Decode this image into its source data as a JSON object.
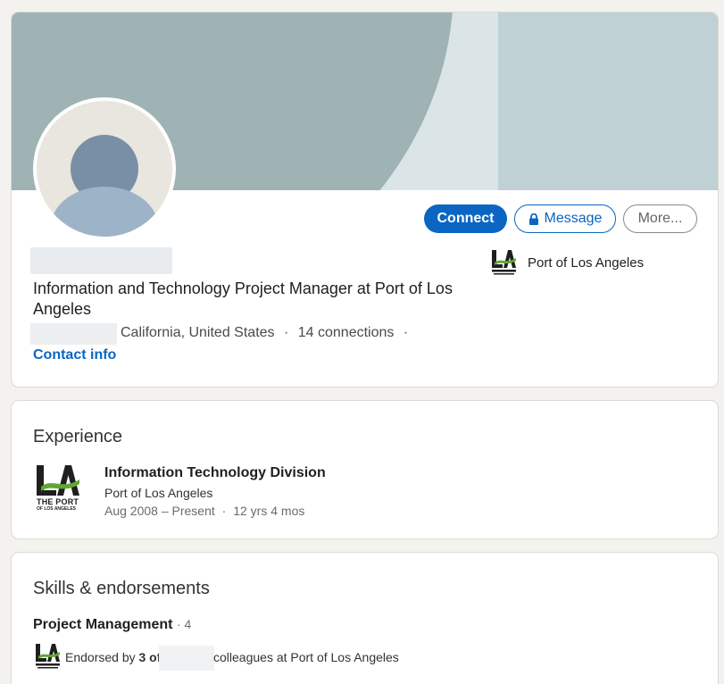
{
  "profile": {
    "headline": "Information and Technology Project Manager at Port of Los Angeles",
    "location": "California, United States",
    "separator": "·",
    "connections": "14 connections",
    "trailing_dot": "·",
    "contact_info": "Contact info",
    "current_company": "Port of Los Angeles"
  },
  "actions": {
    "connect": "Connect",
    "message": "Message",
    "more": "More..."
  },
  "experience": {
    "title": "Experience",
    "items": [
      {
        "role": "Information Technology Division",
        "company": "Port of Los Angeles",
        "dates": "Aug 2008 – Present",
        "duration": "12 yrs 4 mos",
        "logo_text_1": "THE PORT",
        "logo_text_2": "OF LOS ANGELES"
      }
    ]
  },
  "skills": {
    "title": "Skills & endorsements",
    "items": [
      {
        "name": "Project Management",
        "count": "· 4",
        "endorsed_prefix": "Endorsed by",
        "endorsed_count": "3 of",
        "endorsed_suffix": "colleagues at Port of Los Angeles"
      }
    ]
  },
  "colors": {
    "accent": "#0a66c2",
    "logo_green": "#5fa733",
    "logo_dark": "#1f1f1f"
  },
  "icons": {
    "lock": "lock-icon",
    "avatar": "person-placeholder-icon",
    "company_logo": "port-of-la-logo"
  }
}
